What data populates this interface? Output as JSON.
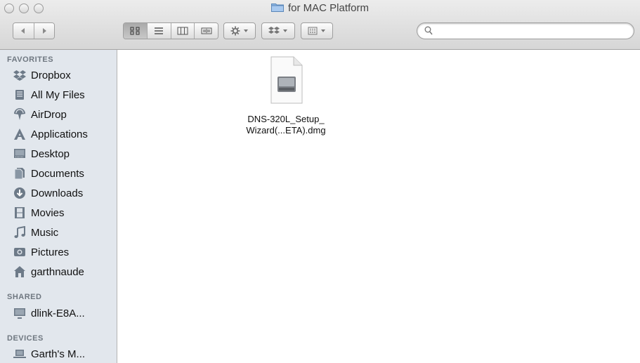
{
  "window": {
    "title": "for MAC Platform"
  },
  "search": {
    "placeholder": "",
    "value": ""
  },
  "sidebar": {
    "favorites_header": "FAVORITES",
    "favorites": [
      {
        "label": "Dropbox",
        "icon": "dropbox-icon"
      },
      {
        "label": "All My Files",
        "icon": "all-my-files-icon"
      },
      {
        "label": "AirDrop",
        "icon": "airdrop-icon"
      },
      {
        "label": "Applications",
        "icon": "applications-icon"
      },
      {
        "label": "Desktop",
        "icon": "desktop-icon"
      },
      {
        "label": "Documents",
        "icon": "documents-icon"
      },
      {
        "label": "Downloads",
        "icon": "downloads-icon"
      },
      {
        "label": "Movies",
        "icon": "movies-icon"
      },
      {
        "label": "Music",
        "icon": "music-icon"
      },
      {
        "label": "Pictures",
        "icon": "pictures-icon"
      },
      {
        "label": "garthnaude",
        "icon": "home-icon"
      }
    ],
    "shared_header": "SHARED",
    "shared": [
      {
        "label": "dlink-E8A...",
        "icon": "network-computer-icon"
      }
    ],
    "devices_header": "DEVICES",
    "devices": [
      {
        "label": "Garth's M...",
        "icon": "laptop-icon"
      }
    ]
  },
  "files": [
    {
      "name_line1": "DNS-320L_Setup_",
      "name_line2": "Wizard(...ETA).dmg",
      "icon": "disk-image-icon"
    }
  ],
  "colors": {
    "sidebar_bg": "#e2e7ed",
    "sidebar_icon": "#6d7a88",
    "toolbar_top": "#ececec",
    "toolbar_bottom": "#d6d6d6"
  }
}
